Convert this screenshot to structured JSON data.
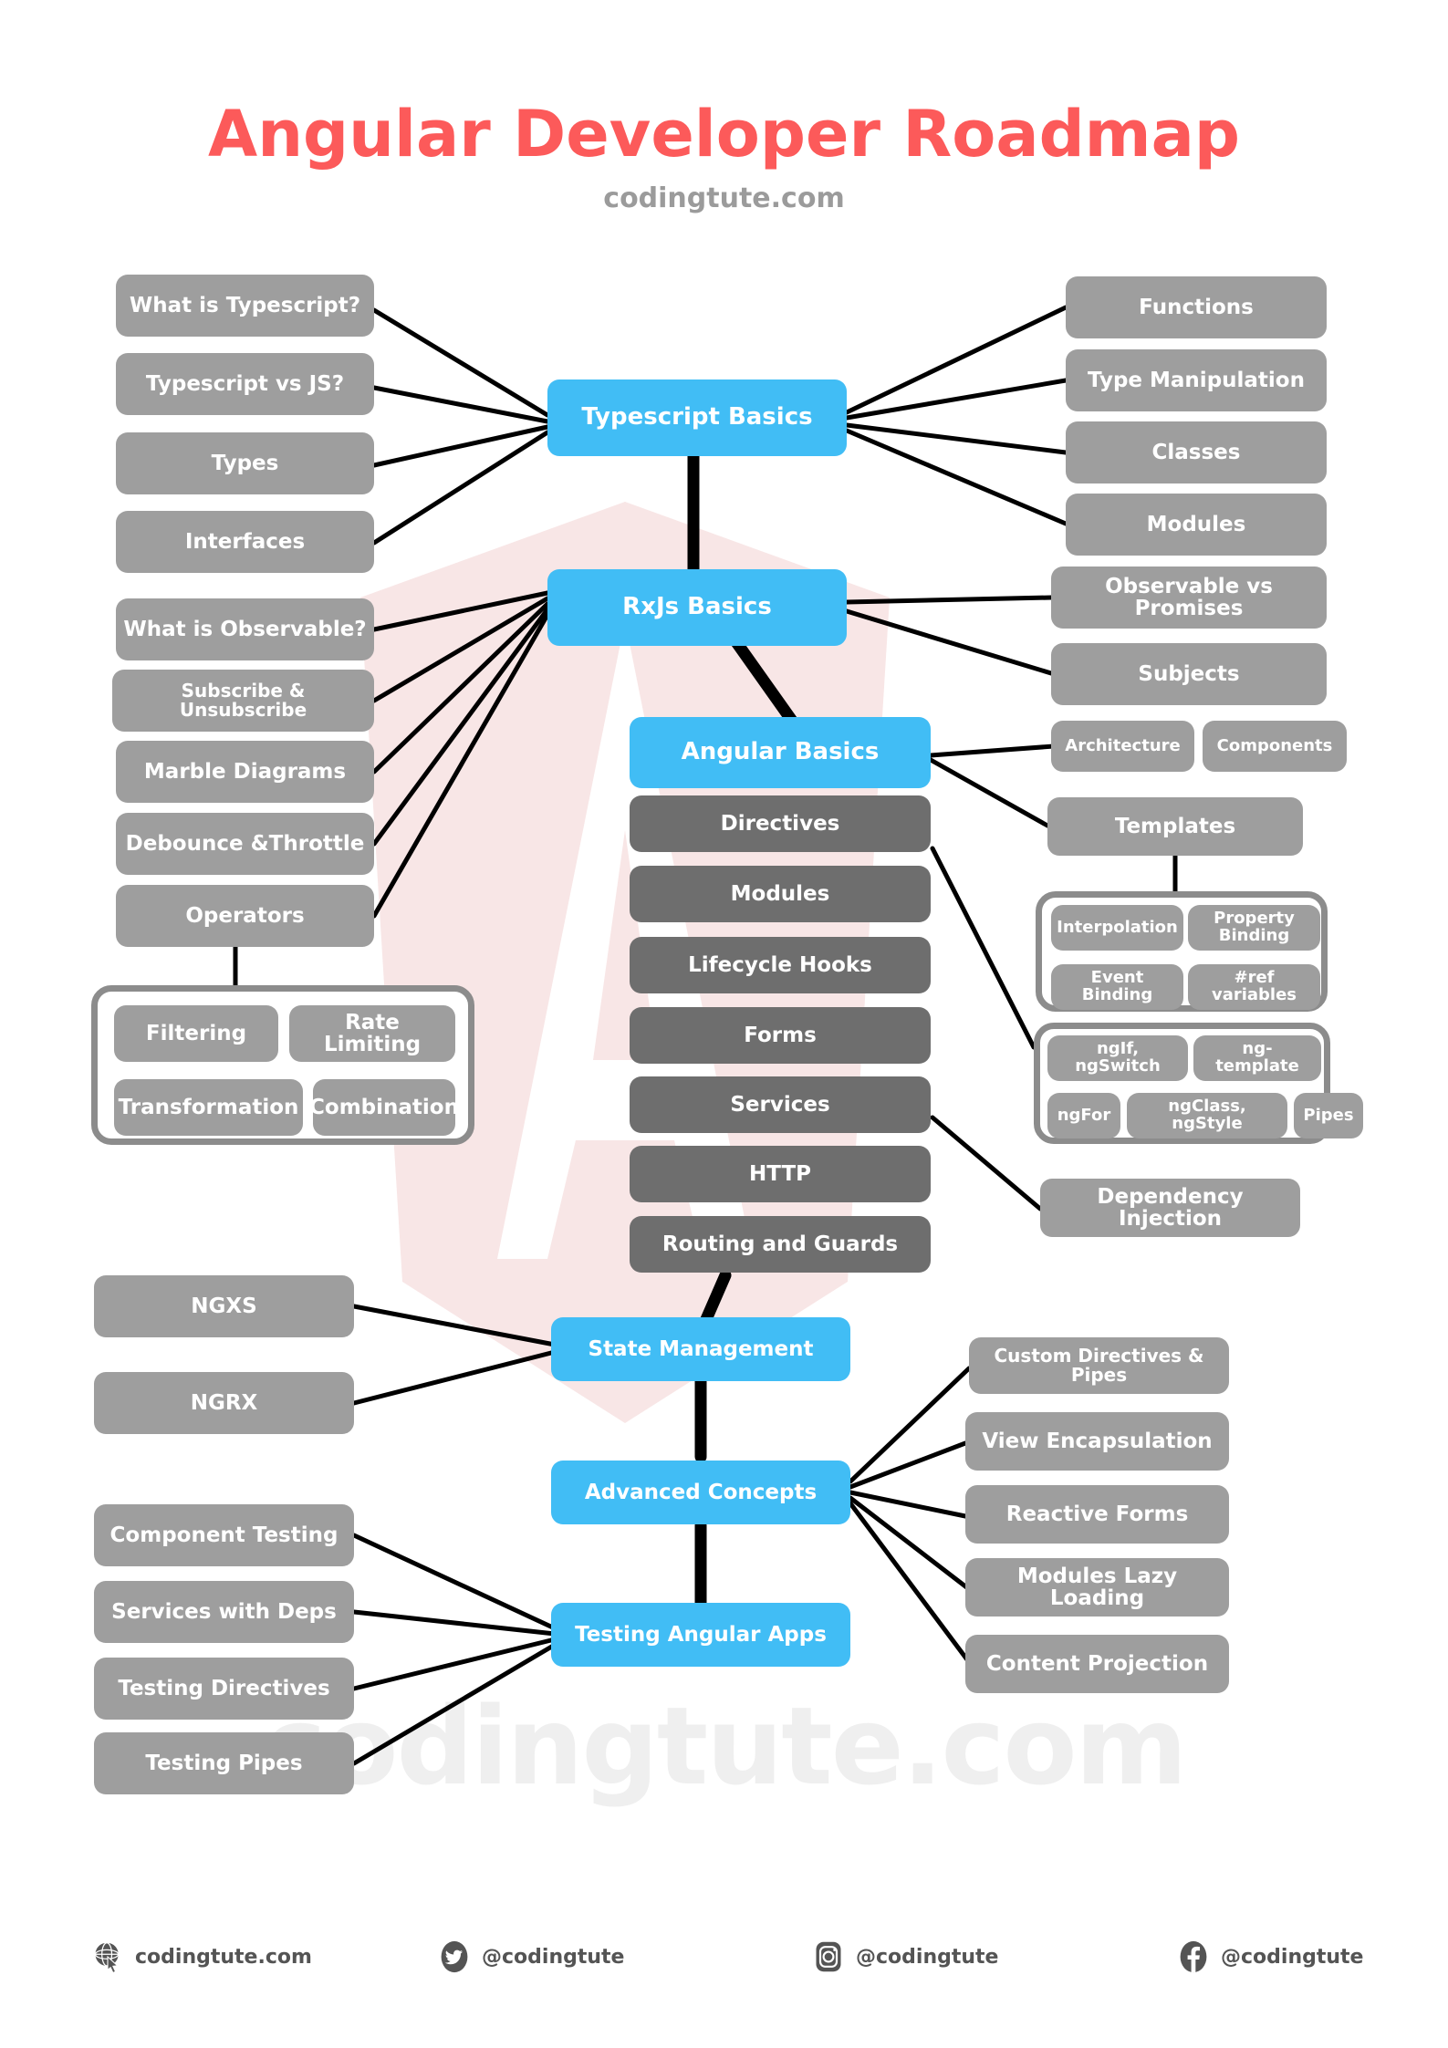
{
  "header": {
    "title": "Angular Developer Roadmap",
    "subtitle": "codingtute.com"
  },
  "watermark": {
    "text": "codingtute.com",
    "logo": "angular-shield-logo"
  },
  "colors": {
    "title": "#FC5A5A",
    "primary_node": "#41BDF5",
    "secondary_node": "#9E9E9E",
    "dark_node": "#6E6E6E",
    "edge": "#000000",
    "watermark_logo": "#F8E6E6",
    "watermark_text": "#EFEFEF",
    "background": "#FFFFFF"
  },
  "nodes": {
    "typescript_basics": "Typescript Basics",
    "rxjs_basics": "RxJs Basics",
    "angular_basics": "Angular Basics",
    "state_management": "State Management",
    "advanced_concepts": "Advanced Concepts",
    "testing_angular_apps": "Testing Angular Apps"
  },
  "typescript_left": [
    "What is Typescript?",
    "Typescript vs JS?",
    "Types",
    "Interfaces"
  ],
  "typescript_right": [
    "Functions",
    "Type Manipulation",
    "Classes",
    "Modules"
  ],
  "rxjs_left": [
    "What is Observable?",
    "Subscribe & Unsubscribe",
    "Marble Diagrams",
    "Debounce &Throttle",
    "Operators"
  ],
  "rxjs_right": [
    "Observable vs Promises",
    "Subjects"
  ],
  "operators_group": [
    "Filtering",
    "Rate Limiting",
    "Transformation",
    "Combination"
  ],
  "angular_column": [
    "Directives",
    "Modules",
    "Lifecycle Hooks",
    "Forms",
    "Services",
    "HTTP",
    "Routing and Guards"
  ],
  "angular_right": [
    "Architecture",
    "Components",
    "Templates",
    "Dependency Injection"
  ],
  "templates_group": [
    "Interpolation",
    "Property Binding",
    "Event Binding",
    "#ref variables"
  ],
  "directives_group": [
    "ngIf, ngSwitch",
    "ng-template",
    "ngFor",
    "ngClass, ngStyle",
    "Pipes"
  ],
  "state_left": [
    "NGXS",
    "NGRX"
  ],
  "advanced_right": [
    "Custom Directives & Pipes",
    "View Encapsulation",
    "Reactive Forms",
    "Modules Lazy Loading",
    "Content Projection"
  ],
  "testing_left": [
    "Component Testing",
    "Services with Deps",
    "Testing Directives",
    "Testing Pipes"
  ],
  "footer": [
    {
      "icon": "globe-icon",
      "label": "codingtute.com"
    },
    {
      "icon": "twitter-icon",
      "label": "@codingtute"
    },
    {
      "icon": "instagram-icon",
      "label": "@codingtute"
    },
    {
      "icon": "facebook-icon",
      "label": "@codingtute"
    }
  ]
}
